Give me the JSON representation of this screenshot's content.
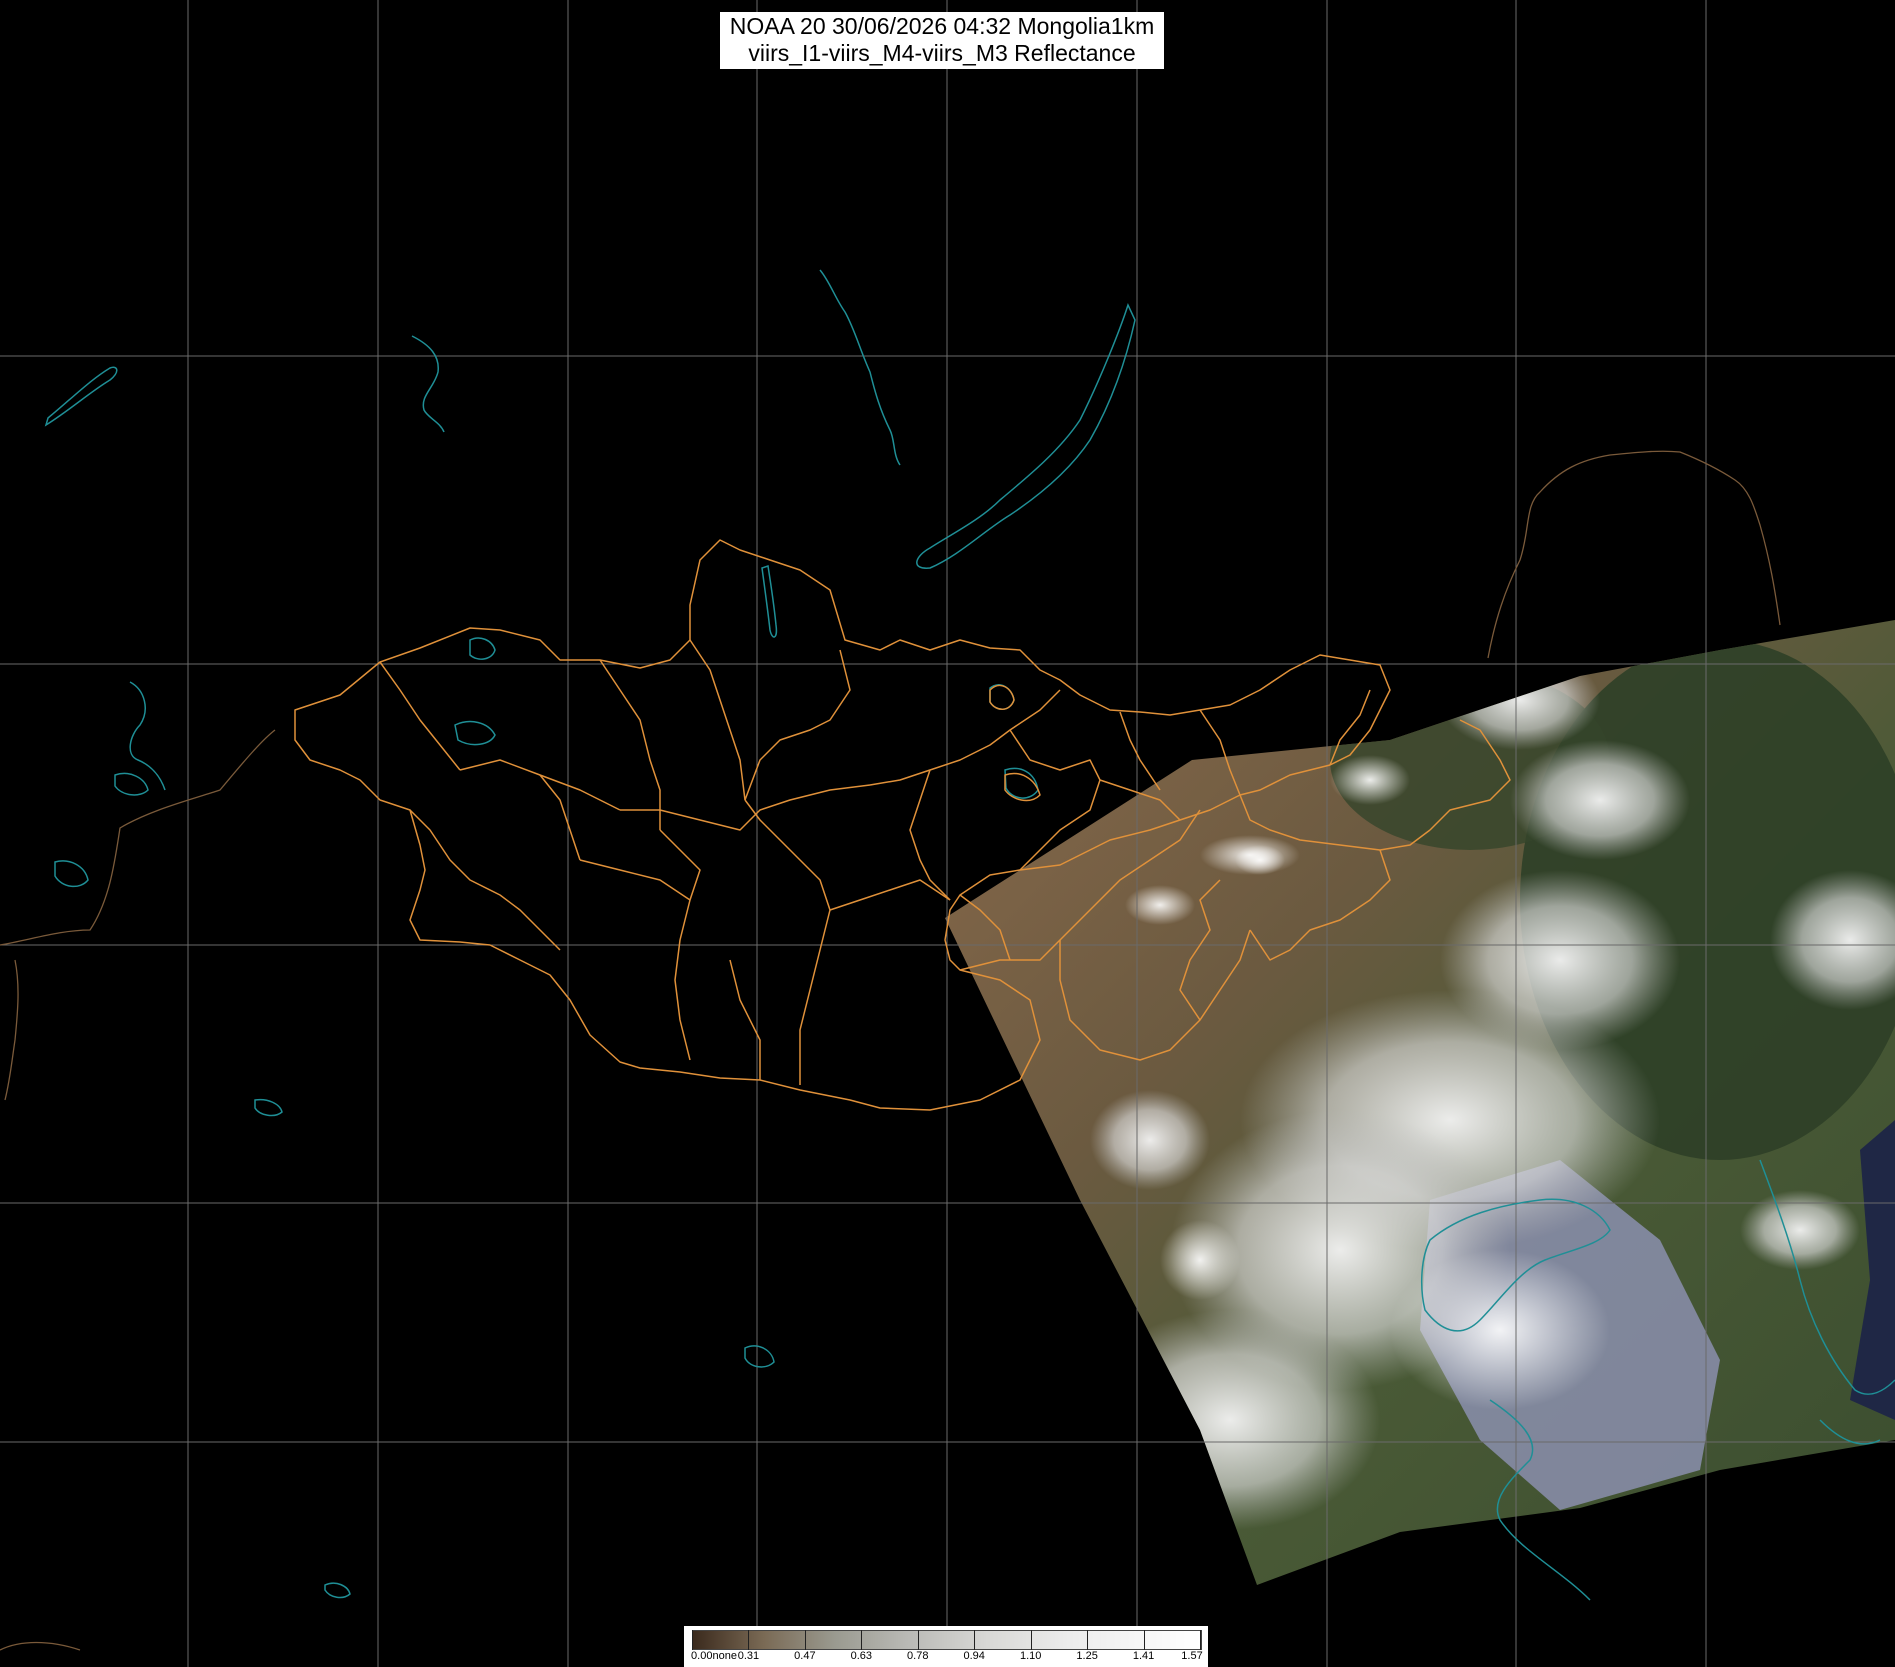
{
  "title": {
    "line1": "NOAA 20 30/06/2026 04:32 Mongolia1km",
    "line2": "viirs_I1-viirs_M4-viirs_M3 Reflectance"
  },
  "colorbar": {
    "labels": [
      "0.00none",
      "0.31",
      "0.47",
      "0.63",
      "0.78",
      "0.94",
      "1.10",
      "1.25",
      "1.41",
      "1.57"
    ]
  },
  "colors": {
    "background": "#000000",
    "grid": "#6a6a6a",
    "province_borders": "#e0913a",
    "coastline_water": "#1f8f96",
    "country_borders": "#7a5a3a"
  }
}
